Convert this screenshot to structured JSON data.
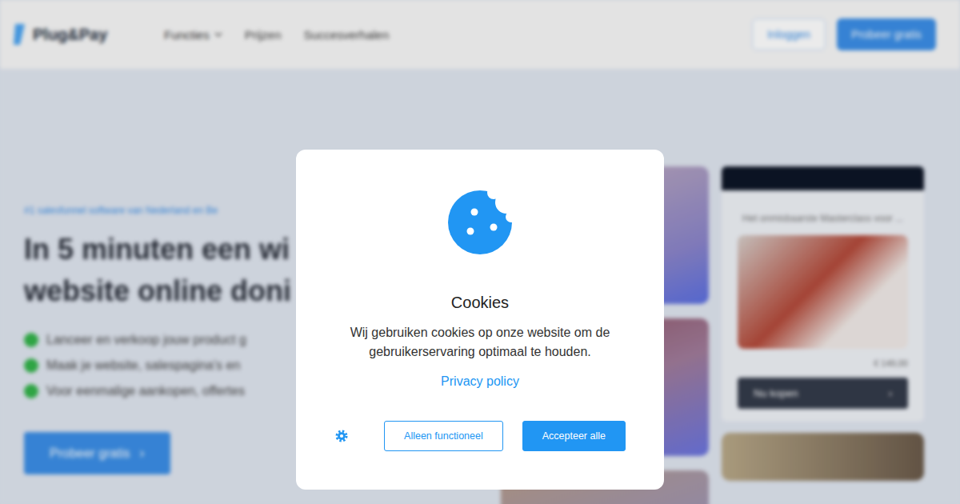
{
  "header": {
    "logo": "Plug&Pay",
    "nav": [
      {
        "label": "Functies",
        "expandable": true
      },
      {
        "label": "Prijzen",
        "expandable": false
      },
      {
        "label": "Succesverhalen",
        "expandable": false
      }
    ],
    "login_button": "Inloggen",
    "trial_button": "Probeer gratis"
  },
  "hero": {
    "tagline": "#1 salesfunnel software van Nederland en Be",
    "title_lines": [
      "In 5 minuten een wi",
      "website online doni"
    ],
    "bullets": [
      "Lanceer en verkoop jouw product g",
      "Maak je website, salespagina's en",
      "Voor eenmalige aankopen, offertes"
    ],
    "cta": "Probeer gratis",
    "cta_arrow": "›"
  },
  "product_card": {
    "title": "Het onmisbaarste Masterclass voor ...",
    "price": "€ 149,00",
    "button": "Nu kopen",
    "button_arrow": "›"
  },
  "cookie_dialog": {
    "title": "Cookies",
    "message": "Wij gebruiken cookies op onze website om de gebruikerservaring optimaal te houden.",
    "link": "Privacy policy",
    "buttons": [
      {
        "label": "Alleen functioneel",
        "primary": false
      },
      {
        "label": "Accepteer alle",
        "primary": true
      }
    ]
  }
}
